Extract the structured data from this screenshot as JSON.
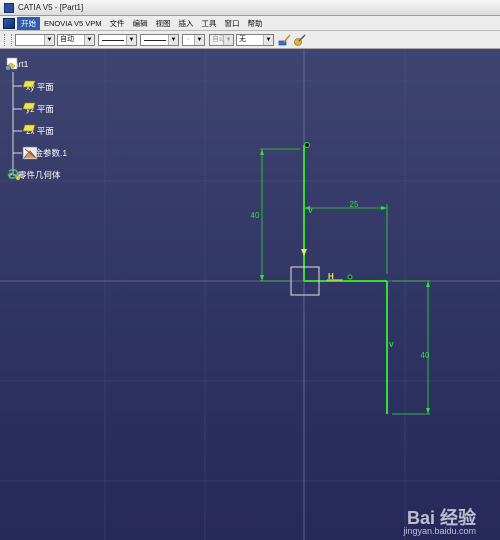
{
  "window": {
    "title": "CATIA V5 - [Part1]"
  },
  "menu": {
    "items": [
      "开始",
      "ENOVIA V5 VPM",
      "文件",
      "编辑",
      "视图",
      "插入",
      "工具",
      "窗口",
      "帮助"
    ]
  },
  "toolbar": {
    "color_value": "",
    "transparency_value": "自动",
    "line_width_value": "",
    "linetype_value": "",
    "point_type_value": "",
    "layer_value": "自动",
    "layer_filter_value": "无"
  },
  "tree": {
    "root": "Part1",
    "items": [
      {
        "label": "xy 平面",
        "icon": "plane-icon"
      },
      {
        "label": "yz 平面",
        "icon": "plane-icon"
      },
      {
        "label": "zx 平面",
        "icon": "plane-icon"
      },
      {
        "label": "钣金参数.1",
        "icon": "sheetmetal-parameters-icon"
      },
      {
        "label": "零件几何体",
        "icon": "part-body-icon"
      }
    ]
  },
  "sketch": {
    "dimensions": [
      "40",
      "25",
      "40"
    ],
    "constraints": {
      "vertical_left": "V",
      "horizontal": "H",
      "vertical_right": "V"
    }
  },
  "colors": {
    "sketch_green": "#33dd33",
    "background_top": "#3f4470",
    "background_bottom": "#26295a",
    "accent": "#2f5bb0"
  },
  "watermark": {
    "brand": "Bai 经验",
    "url": "jingyan.baidu.com"
  }
}
